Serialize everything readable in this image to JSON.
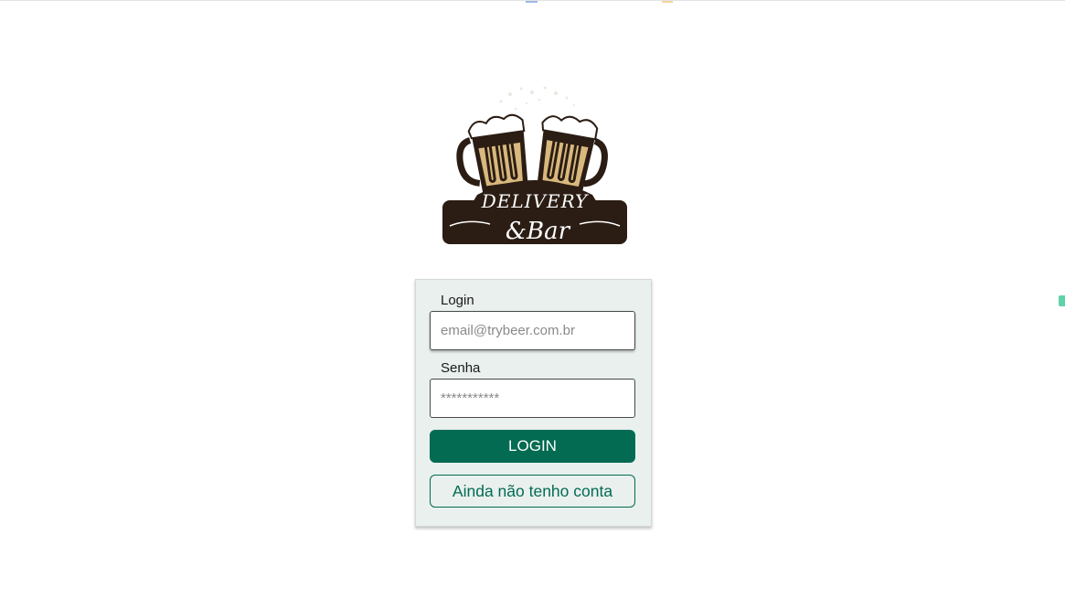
{
  "logo": {
    "name": "delivery-bar-logo",
    "line1": "DELIVERY",
    "line2": "&Bar"
  },
  "form": {
    "login_label": "Login",
    "login_placeholder": "email@trybeer.com.br",
    "password_label": "Senha",
    "password_placeholder": "***********",
    "login_button": "LOGIN",
    "register_button": "Ainda não tenho conta"
  },
  "colors": {
    "primary": "#036b52",
    "card_background": "#e9f0ee",
    "logo_brown": "#2b1d14",
    "beer": "#d8b87c"
  }
}
